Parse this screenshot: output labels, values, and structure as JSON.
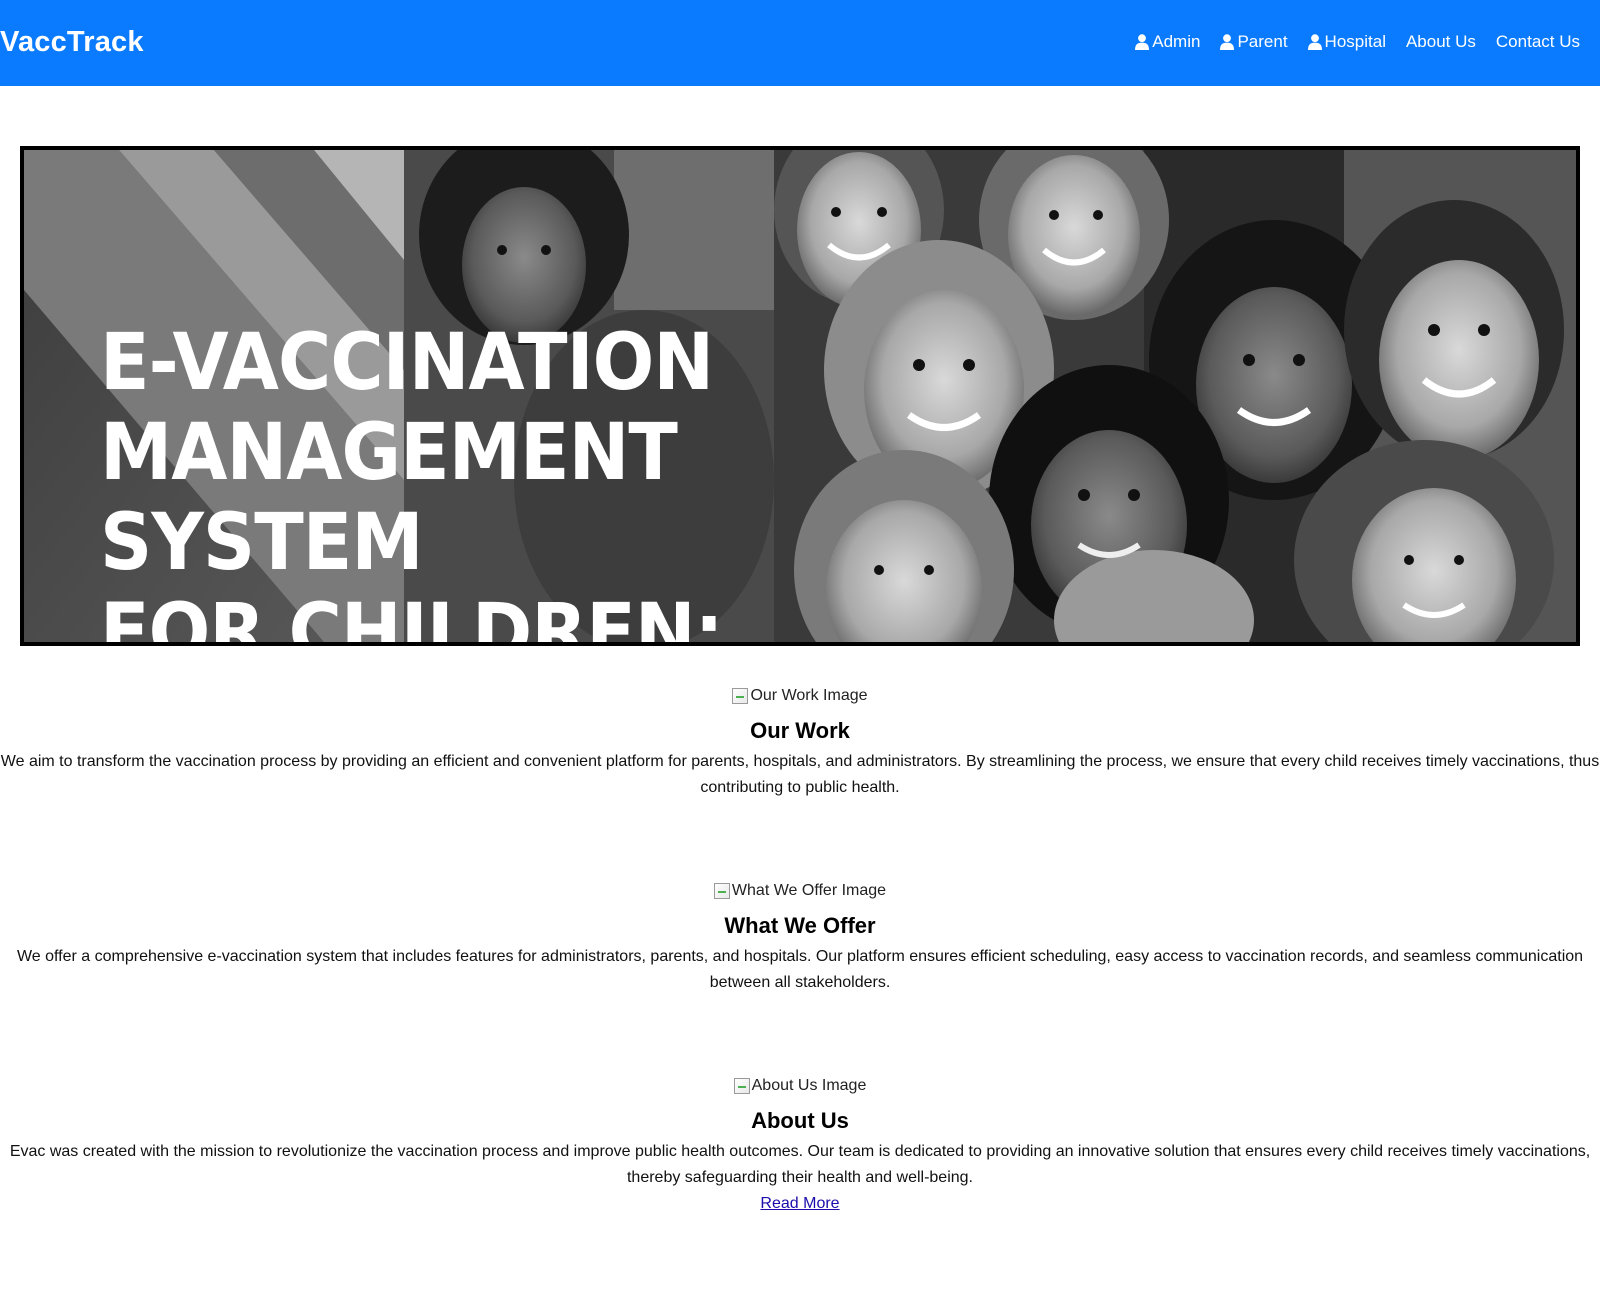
{
  "header": {
    "brand": "VaccTrack",
    "nav": [
      {
        "label": "Admin",
        "icon": "user-icon"
      },
      {
        "label": "Parent",
        "icon": "user-icon"
      },
      {
        "label": "Hospital",
        "icon": "user-icon"
      },
      {
        "label": "About Us"
      },
      {
        "label": "Contact Us"
      }
    ],
    "background_color": "#0a7bff"
  },
  "hero": {
    "title_lines": [
      "E-VACCINATION",
      "MANAGEMENT",
      "SYSTEM",
      "FOR CHILDREN:"
    ]
  },
  "sections": [
    {
      "image_alt": "Our Work Image",
      "title": "Our Work",
      "text": "We aim to transform the vaccination process by providing an efficient and convenient platform for parents, hospitals, and administrators. By streamlining the process, we ensure that every child receives timely vaccinations, thus contributing to public health."
    },
    {
      "image_alt": "What We Offer Image",
      "title": "What We Offer",
      "text": "We offer a comprehensive e-vaccination system that includes features for administrators, parents, and hospitals. Our platform ensures efficient scheduling, easy access to vaccination records, and seamless communication between all stakeholders."
    },
    {
      "image_alt": "About Us Image",
      "title": "About Us",
      "text": "Evac was created with the mission to revolutionize the vaccination process and improve public health outcomes. Our team is dedicated to providing an innovative solution that ensures every child receives timely vaccinations, thereby safeguarding their health and well-being.",
      "link": "Read More"
    }
  ]
}
